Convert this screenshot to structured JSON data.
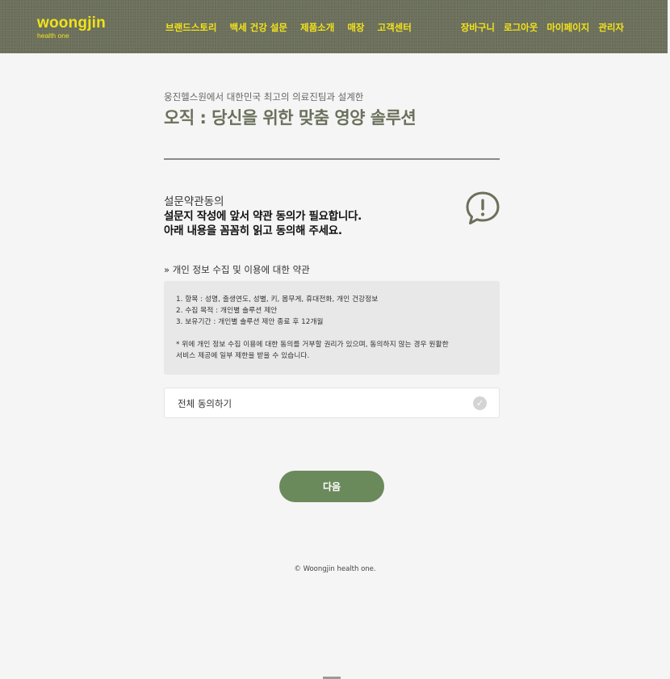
{
  "header": {
    "logo_main": "woongjin",
    "logo_sub": "health one",
    "nav": [
      "브랜드스토리",
      "백세 건강 설문",
      "제품소개",
      "매장",
      "고객센터"
    ],
    "nav_right": [
      "장바구니",
      "로그아웃",
      "마이페이지",
      "관리자"
    ]
  },
  "hero": {
    "eyebrow": "웅진헬스원에서 대한민국 최고의 의료진팀과 설계한",
    "headline": "오직 : 당신을 위한 맞춤 영양 솔루션"
  },
  "consent": {
    "title": "설문약관동의",
    "line1": "설문지 작성에 앞서 약관 동의가 필요합니다.",
    "line2": "아래 내용을 꼼꼼히 읽고 동의해 주세요.",
    "icon": "alert-speech-icon"
  },
  "terms": {
    "label": "» 개인 정보 수집 및 이용에 대한 약관",
    "item1": "1. 항목 : 성명, 출생연도, 성별, 키, 몸무게, 휴대전화, 개인 건강정보",
    "item2": "2. 수집 목적 : 개인별 솔루션 제안",
    "item3": "3. 보유기간 : 개인별 솔루션 제안 종료 후 12개월",
    "note1": "* 위에 개인 정보 수집 이용에 대한 동의를 거부할 권리가 있으며, 동의하지 않는 경우 원활한",
    "note2": "서비스 제공에 일부 제한을 받을 수 있습니다."
  },
  "agree": {
    "label": "전체 동의하기",
    "check_glyph": "✓"
  },
  "next_button": "다음",
  "footer": "© Woongjin health one.",
  "colors": {
    "header_bg": "#6b705b",
    "brand_yellow": "#f2e21a",
    "headline": "#6b705b",
    "button": "#6b8a5c"
  }
}
